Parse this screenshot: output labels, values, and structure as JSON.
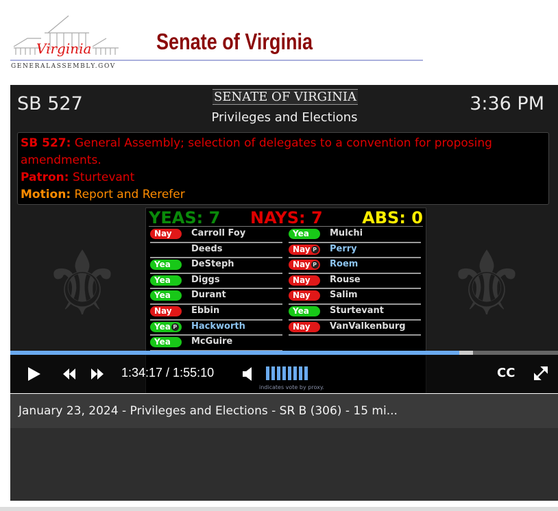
{
  "header": {
    "logo_script": "Virginia",
    "logo_text": "GENERALASSEMBLY.GOV",
    "title": "Senate of Virginia"
  },
  "video": {
    "bill_number": "SB 527",
    "clock": "3:36 PM",
    "chamber": "SENATE OF VIRGINIA",
    "committee": "Privileges and Elections",
    "bill_label": "SB 527:",
    "bill_desc": "General Assembly; selection of delegates to a convention for proposing amendments.",
    "patron_label": "Patron:",
    "patron": "Sturtevant",
    "motion_label": "Motion:",
    "motion": "Report and Rerefer",
    "tallies": {
      "yeas": "YEAS:  7",
      "nays": "NAYS:  7",
      "abs": "ABS: 0"
    },
    "proxy_symbol": "P",
    "votes_left": [
      {
        "vote": "Nay",
        "name": "Carroll Foy",
        "proxy": false
      },
      {
        "vote": "",
        "name": "Deeds",
        "proxy": false
      },
      {
        "vote": "Yea",
        "name": "DeSteph",
        "proxy": false
      },
      {
        "vote": "Yea",
        "name": "Diggs",
        "proxy": false
      },
      {
        "vote": "Yea",
        "name": "Durant",
        "proxy": false
      },
      {
        "vote": "Nay",
        "name": "Ebbin",
        "proxy": false
      },
      {
        "vote": "Yea",
        "name": "Hackworth",
        "proxy": true
      },
      {
        "vote": "Yea",
        "name": "McGuire",
        "proxy": false
      }
    ],
    "votes_right": [
      {
        "vote": "Yea",
        "name": "Mulchi",
        "proxy": false
      },
      {
        "vote": "Nay",
        "name": "Perry",
        "proxy": true
      },
      {
        "vote": "Nay",
        "name": "Roem",
        "proxy": true
      },
      {
        "vote": "Nay",
        "name": "Rouse",
        "proxy": false
      },
      {
        "vote": "Nay",
        "name": "Salim",
        "proxy": false
      },
      {
        "vote": "Yea",
        "name": "Sturtevant",
        "proxy": false
      },
      {
        "vote": "Nay",
        "name": "VanValkenburg",
        "proxy": false
      }
    ],
    "proxy_note": "indicates vote by proxy.",
    "time": "1:34:17 / 1:55:10",
    "progress_percent": 82,
    "volume_percent": 100,
    "cc_label": "CC",
    "colors": {
      "yea": "#18c818",
      "nay": "#e01818",
      "yeas_text": "#0a8a0a",
      "nays_text": "#e00000",
      "abs_text": "#ffee00",
      "progress": "#6aaaf0"
    }
  },
  "caption": "January 23, 2024 - Privileges and Elections - SR B (306) - 15 mi..."
}
